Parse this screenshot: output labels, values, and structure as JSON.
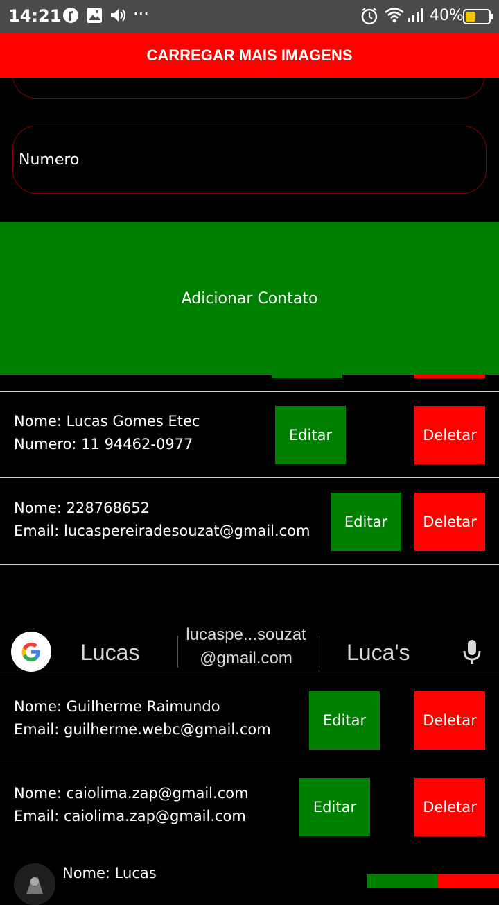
{
  "status_bar": {
    "time": "14:21",
    "battery_percent": "40%",
    "icons": [
      "music-icon",
      "image-icon",
      "volume-icon",
      "more-icon",
      "alarm-icon",
      "wifi-icon",
      "signal-icon",
      "battery-icon"
    ],
    "more_dots": "···"
  },
  "top_button": {
    "label": "CARREGAR MAIS IMAGENS",
    "color": "#ff0000"
  },
  "form": {
    "numero_label": "Numero",
    "add_button": "Adicionar Contato",
    "add_color": "#008000"
  },
  "contacts": [
    {
      "line1": "Nome: Lucas Gomes Etec",
      "line2": "Numero: 11 94462-0977",
      "edit": "Editar",
      "delete": "Deletar"
    },
    {
      "line1": "Nome: 228768652",
      "line2": "Email: lucaspereiradesouzat@gmail.com",
      "edit": "Editar",
      "delete": "Deletar"
    },
    {
      "line1": "Nome: Guilherme Raimundo",
      "line2": "Email: guilherme.webc@gmail.com",
      "edit": "Editar",
      "delete": "Deletar"
    },
    {
      "line1": "Nome: caiolima.zap@gmail.com",
      "line2": "Email: caiolima.zap@gmail.com",
      "edit": "Editar",
      "delete": "Deletar"
    }
  ],
  "last_contact": {
    "line1": "Nome: Lucas"
  },
  "keyboard_suggestions": {
    "left": "Lucas",
    "middle_line1": "lucaspe...souzat",
    "middle_line2": "@gmail.com",
    "right": "Luca's"
  }
}
